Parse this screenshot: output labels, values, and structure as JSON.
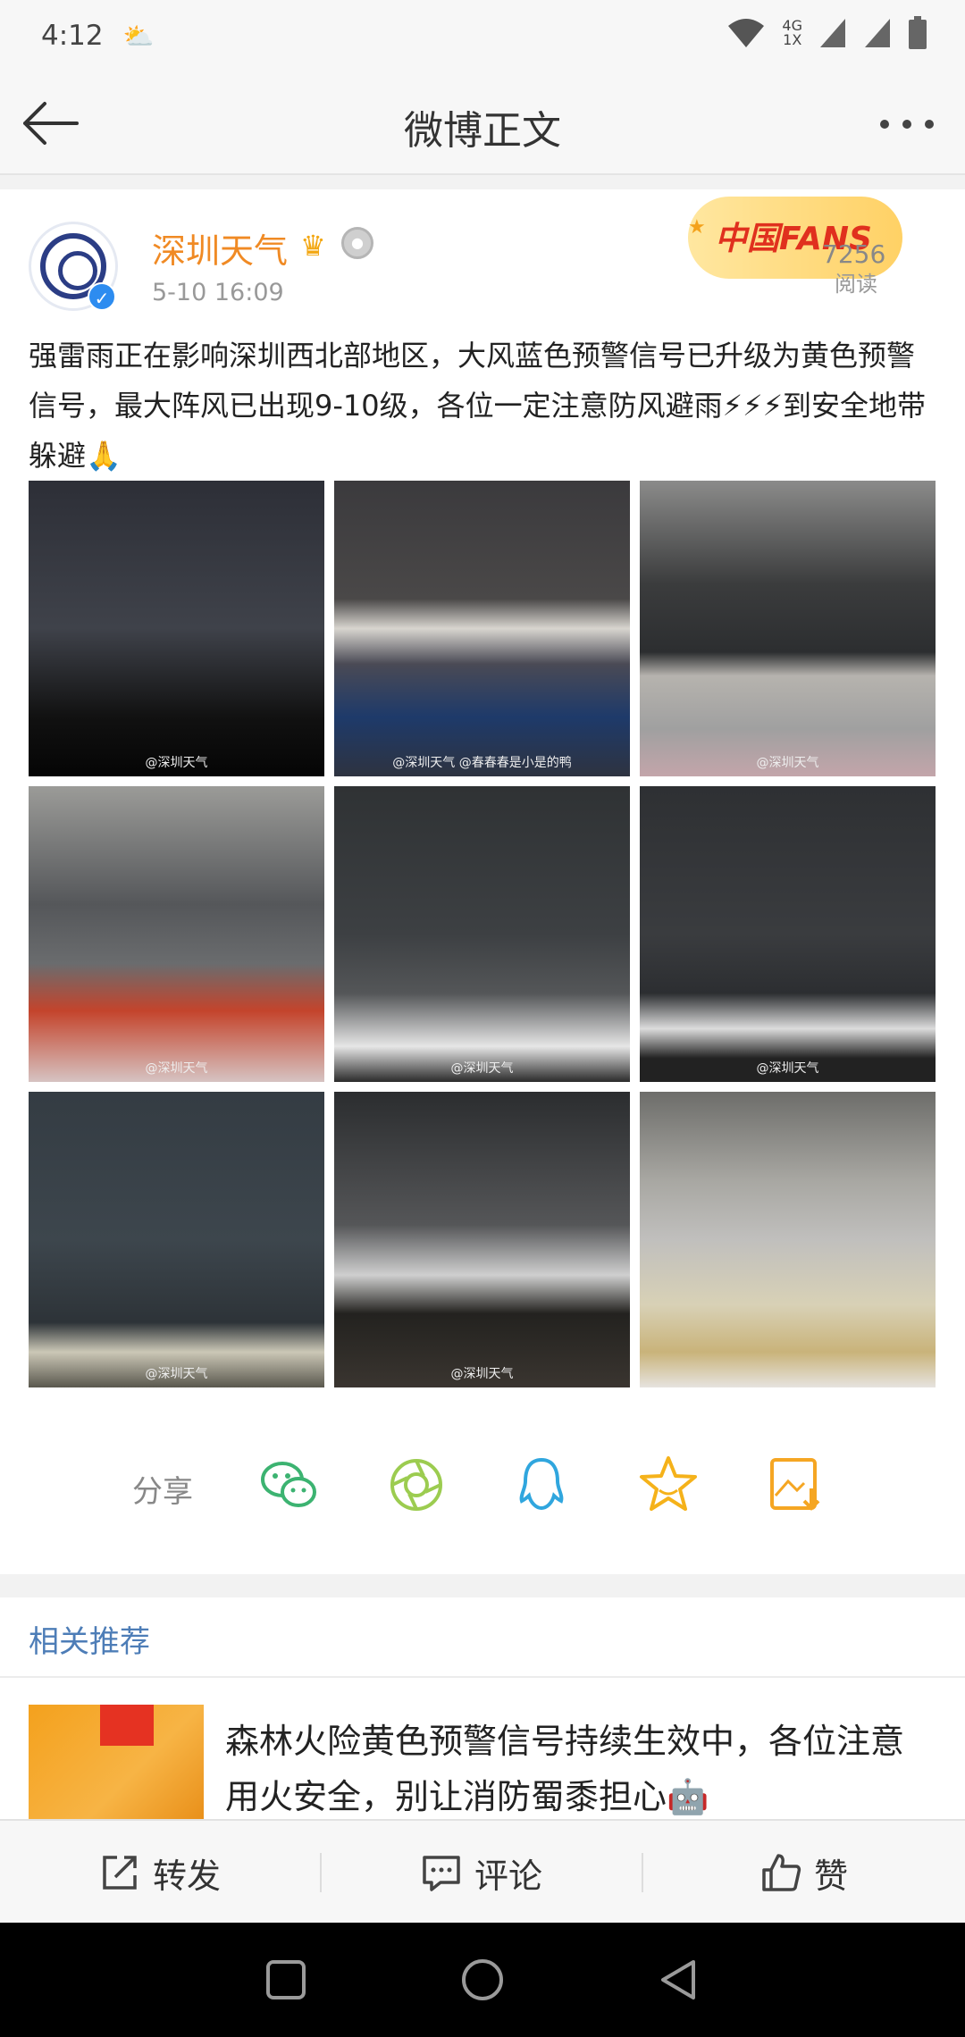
{
  "status_bar": {
    "time": "4:12",
    "network_top": "4G",
    "network_bottom": "1X"
  },
  "nav": {
    "title": "微博正文"
  },
  "post": {
    "username": "深圳天气",
    "timestamp": "5-10 16:09",
    "fans_badge_text": "中国FANS",
    "reads_count": "7256",
    "reads_label": "阅读",
    "content": "强雷雨正在影响深圳西北部地区，大风蓝色预警信号已升级为黄色预警信号，最大阵风已出现9-10级，各位一定注意防风避雨⚡⚡⚡到安全地带躲避🙏",
    "photos": [
      {
        "watermark": "@深圳天气"
      },
      {
        "watermark": "@深圳天气 @春春春是小是的鸭"
      },
      {
        "watermark": "@深圳天气"
      },
      {
        "watermark": "@深圳天气"
      },
      {
        "watermark": "@深圳天气"
      },
      {
        "watermark": "@深圳天气"
      },
      {
        "watermark": "@深圳天气"
      },
      {
        "watermark": "@深圳天气"
      },
      {
        "watermark": ""
      }
    ]
  },
  "share": {
    "label": "分享",
    "icons": [
      "wechat-icon",
      "moments-icon",
      "qq-icon",
      "favorite-icon",
      "save-image-icon"
    ]
  },
  "related": {
    "header": "相关推荐",
    "items": [
      {
        "text": "森林火险黄色预警信号持续生效中，各位注意用火安全，别让消防蜀黍担心🤖"
      }
    ]
  },
  "actions": {
    "repost": "转发",
    "comment": "评论",
    "like": "赞"
  },
  "colors": {
    "accent_orange": "#f08a24",
    "link_blue": "#4d7db7",
    "wechat_green": "#3cb371",
    "qq_blue": "#30a6de",
    "star_yellow": "#f5b21a"
  }
}
